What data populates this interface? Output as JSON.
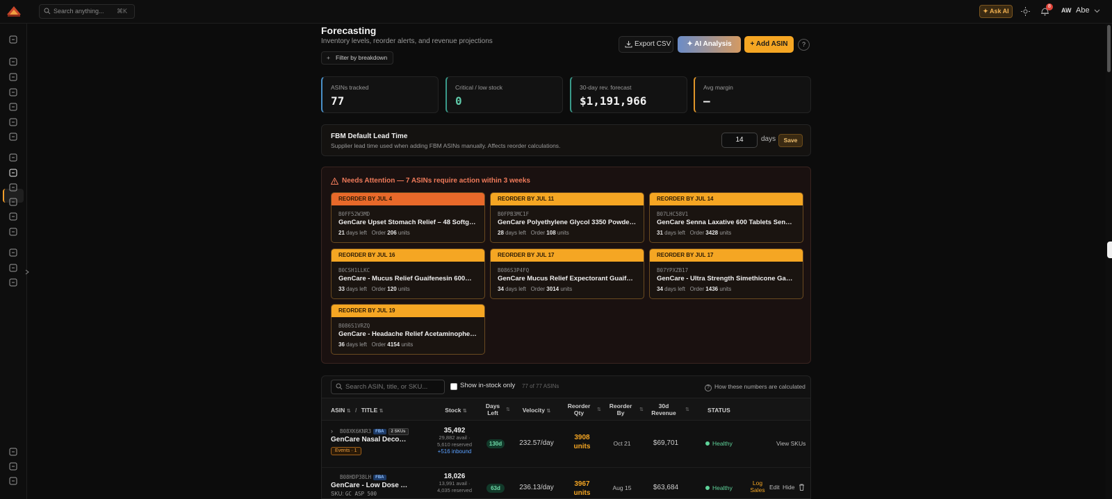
{
  "topbar": {
    "search_placeholder": "Search anything...",
    "search_shortcut": "⌘K",
    "ask_ai_label": "✦ Ask AI",
    "notification_count": "8",
    "avatar_initials": "AW",
    "user_name": "Abe"
  },
  "sidebar": {
    "icons": [
      "dashboard-icon",
      "megaphone-icon",
      "sparkle-icon",
      "clipboard-icon",
      "search-icon",
      "users-icon",
      "tag-icon",
      "cart-icon",
      "chart-icon",
      "activity-icon",
      "document-icon",
      "folder-icon",
      "star-icon",
      "wallet-icon",
      "trend-icon",
      "shield-icon",
      "bug-icon",
      "card-icon",
      "settings-icon"
    ],
    "active": "chart-icon"
  },
  "header": {
    "title": "Forecasting",
    "subtitle": "Inventory levels, reorder alerts, and revenue projections",
    "filter_label": "Filter by breakdown",
    "export_label": "Export CSV",
    "ai_label": "✦ AI Analysis",
    "add_label": "+ Add ASIN",
    "help_label": "?"
  },
  "kpis": [
    {
      "label": "ASINs tracked",
      "value": "77"
    },
    {
      "label": "Critical / low stock",
      "value": "0"
    },
    {
      "label": "30-day rev. forecast",
      "value": "$1,191,966"
    },
    {
      "label": "Avg margin",
      "value": "—"
    }
  ],
  "lead_time": {
    "title": "FBM Default Lead Time",
    "subtitle": "Supplier lead time used when adding FBM ASINs manually. Affects reorder calculations.",
    "value": "14",
    "unit": "days",
    "save_label": "Save"
  },
  "attention": {
    "title": "Needs Attention — 7 ASINs require action within 3 weeks",
    "cards": [
      {
        "header": "REORDER BY JUL 4",
        "asin": "B0FF52W3MD",
        "title": "GenCare Upset Stomach Relief – 48 Softgels…",
        "days": "21",
        "days_label": "days left",
        "order_label": "Order",
        "order": "206",
        "units_label": "units"
      },
      {
        "header": "REORDER BY JUL 11",
        "asin": "B0FPB3MC1F",
        "title": "GenCare Polyethylene Glycol 3350 Powder …",
        "days": "28",
        "days_label": "days left",
        "order_label": "Order",
        "order": "108",
        "units_label": "units"
      },
      {
        "header": "REORDER BY JUL 14",
        "asin": "B07LHC58V1",
        "title": "GenCare Senna Laxative 600 Tablets Senna…",
        "days": "31",
        "days_label": "days left",
        "order_label": "Order",
        "order": "3428",
        "units_label": "units"
      },
      {
        "header": "REORDER BY JUL 16",
        "asin": "B0CSH1LLKC",
        "title": "GenCare - Mucus Relief Guaifenesin 600mg…",
        "days": "33",
        "days_label": "days left",
        "order_label": "Order",
        "order": "120",
        "units_label": "units"
      },
      {
        "header": "REORDER BY JUL 17",
        "asin": "B086S3P4FQ",
        "title": "GenCare Mucus Relief Expectorant Guaifen…",
        "days": "34",
        "days_label": "days left",
        "order_label": "Order",
        "order": "3014",
        "units_label": "units"
      },
      {
        "header": "REORDER BY JUL 17",
        "asin": "B07YPXZB17",
        "title": "GenCare - Ultra Strength Simethicone Gas R…",
        "days": "34",
        "days_label": "days left",
        "order_label": "Order",
        "order": "1436",
        "units_label": "units"
      },
      {
        "header": "REORDER BY JUL 19",
        "asin": "B086S1VRZQ",
        "title": "GenCare - Headache Relief Acetaminophen …",
        "days": "36",
        "days_label": "days left",
        "order_label": "Order",
        "order": "4154",
        "units_label": "units"
      }
    ]
  },
  "table": {
    "search_placeholder": "Search ASIN, title, or SKU...",
    "instock_label": "Show in-stock only",
    "count_text": "77 of 77 ASINs",
    "howto_label": "How these numbers are calculated",
    "columns": {
      "asin": "ASIN",
      "sep": "/",
      "title": "TITLE",
      "stock": "Stock",
      "days_left_1": "Days",
      "days_left_2": "Left",
      "velocity": "Velocity",
      "reorder_qty_1": "Reorder",
      "reorder_qty_2": "Qty",
      "reorder_by_1": "Reorder",
      "reorder_by_2": "By",
      "revenue_1": "30d",
      "revenue_2": "Revenue",
      "status": "STATUS"
    },
    "rows": [
      {
        "asin": "B08XK6KNR3",
        "fba": "FBA",
        "skus": "2 SKUs",
        "title": "GenCare Nasal Deconge…",
        "events": "Events · 1",
        "stock": "35,492",
        "avail": "29,882 avail ·",
        "reserved": "5,610 reserved",
        "inbound": "+516 inbound",
        "days_left": "130d",
        "velocity": "232.57/day",
        "reorder_qty": "3908",
        "reorder_units": "units",
        "reorder_by": "Oct 21",
        "revenue": "$69,701",
        "status": "Healthy",
        "action": "View SKUs"
      },
      {
        "asin": "B08HDP38LH",
        "fba": "FBA",
        "sku_label": "SKU:",
        "sku": "GC ASP 500",
        "title": "GenCare - Low Dose As…",
        "stock": "18,026",
        "avail": "13,991 avail ·",
        "reserved": "4,035 reserved",
        "days_left": "63d",
        "velocity": "236.13/day",
        "reorder_qty": "3967",
        "reorder_units": "units",
        "reorder_by": "Aug 15",
        "revenue": "$63,684",
        "status": "Healthy",
        "log_1": "Log",
        "log_2": "Sales",
        "edit": "Edit",
        "hide": "Hide"
      }
    ]
  }
}
